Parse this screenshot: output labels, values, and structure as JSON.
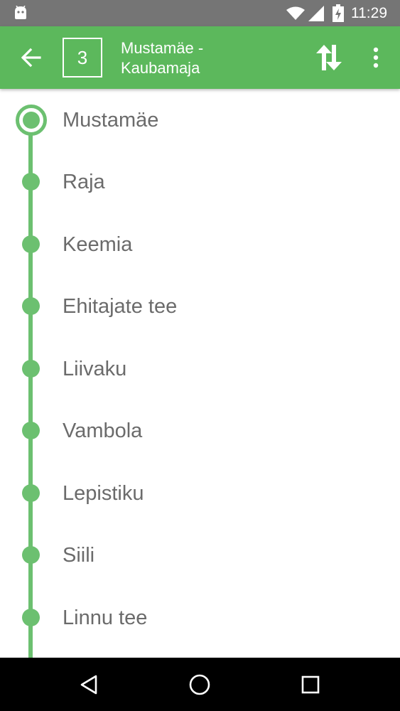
{
  "status_bar": {
    "time": "11:29",
    "icons": [
      "android-icon",
      "wifi-icon",
      "signal-icon",
      "battery-charging-icon"
    ]
  },
  "app_bar": {
    "back_icon": "arrow-left-icon",
    "route_number": "3",
    "title_line1": "Mustamäe -",
    "title_line2": "Kaubamaja",
    "swap_icon": "swap-vertical-icon",
    "menu_icon": "more-vertical-icon",
    "color": "#5cb85c"
  },
  "stops": [
    {
      "name": "Mustamäe",
      "current": true
    },
    {
      "name": "Raja",
      "current": false
    },
    {
      "name": "Keemia",
      "current": false
    },
    {
      "name": "Ehitajate tee",
      "current": false
    },
    {
      "name": "Liivaku",
      "current": false
    },
    {
      "name": "Vambola",
      "current": false
    },
    {
      "name": "Lepistiku",
      "current": false
    },
    {
      "name": "Siili",
      "current": false
    },
    {
      "name": "Linnu tee",
      "current": false
    }
  ],
  "route_line_color": "#6cc070",
  "nav_bar": {
    "icons": [
      "back-triangle-icon",
      "home-circle-icon",
      "recents-square-icon"
    ]
  }
}
